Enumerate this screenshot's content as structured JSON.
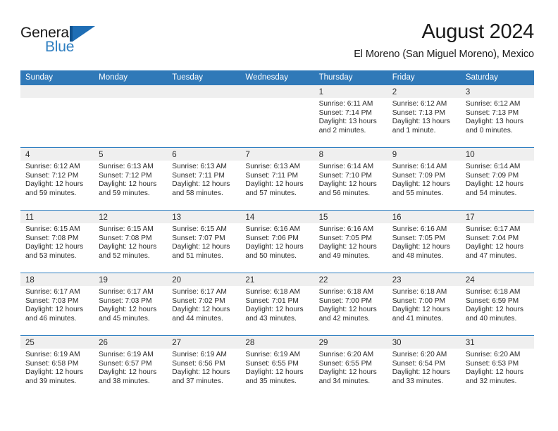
{
  "brand": {
    "name_top": "General",
    "name_bottom": "Blue",
    "mark": "triangle-logo",
    "accent": "#2f7fc1",
    "dark_accent": "#12538f"
  },
  "header": {
    "title": "August 2024",
    "subtitle": "El Moreno (San Miguel Moreno), Mexico"
  },
  "colors": {
    "header_bar": "#3079b8",
    "date_strip": "#efefef",
    "row_rule": "#2f7fc1",
    "text": "#2b2b2b"
  },
  "calendar": {
    "weekdays": [
      "Sunday",
      "Monday",
      "Tuesday",
      "Wednesday",
      "Thursday",
      "Friday",
      "Saturday"
    ],
    "weeks": [
      [
        {
          "day": "",
          "lines": []
        },
        {
          "day": "",
          "lines": []
        },
        {
          "day": "",
          "lines": []
        },
        {
          "day": "",
          "lines": []
        },
        {
          "day": "1",
          "lines": [
            "Sunrise: 6:11 AM",
            "Sunset: 7:14 PM",
            "Daylight: 13 hours",
            "and 2 minutes."
          ]
        },
        {
          "day": "2",
          "lines": [
            "Sunrise: 6:12 AM",
            "Sunset: 7:13 PM",
            "Daylight: 13 hours",
            "and 1 minute."
          ]
        },
        {
          "day": "3",
          "lines": [
            "Sunrise: 6:12 AM",
            "Sunset: 7:13 PM",
            "Daylight: 13 hours",
            "and 0 minutes."
          ]
        }
      ],
      [
        {
          "day": "4",
          "lines": [
            "Sunrise: 6:12 AM",
            "Sunset: 7:12 PM",
            "Daylight: 12 hours",
            "and 59 minutes."
          ]
        },
        {
          "day": "5",
          "lines": [
            "Sunrise: 6:13 AM",
            "Sunset: 7:12 PM",
            "Daylight: 12 hours",
            "and 59 minutes."
          ]
        },
        {
          "day": "6",
          "lines": [
            "Sunrise: 6:13 AM",
            "Sunset: 7:11 PM",
            "Daylight: 12 hours",
            "and 58 minutes."
          ]
        },
        {
          "day": "7",
          "lines": [
            "Sunrise: 6:13 AM",
            "Sunset: 7:11 PM",
            "Daylight: 12 hours",
            "and 57 minutes."
          ]
        },
        {
          "day": "8",
          "lines": [
            "Sunrise: 6:14 AM",
            "Sunset: 7:10 PM",
            "Daylight: 12 hours",
            "and 56 minutes."
          ]
        },
        {
          "day": "9",
          "lines": [
            "Sunrise: 6:14 AM",
            "Sunset: 7:09 PM",
            "Daylight: 12 hours",
            "and 55 minutes."
          ]
        },
        {
          "day": "10",
          "lines": [
            "Sunrise: 6:14 AM",
            "Sunset: 7:09 PM",
            "Daylight: 12 hours",
            "and 54 minutes."
          ]
        }
      ],
      [
        {
          "day": "11",
          "lines": [
            "Sunrise: 6:15 AM",
            "Sunset: 7:08 PM",
            "Daylight: 12 hours",
            "and 53 minutes."
          ]
        },
        {
          "day": "12",
          "lines": [
            "Sunrise: 6:15 AM",
            "Sunset: 7:08 PM",
            "Daylight: 12 hours",
            "and 52 minutes."
          ]
        },
        {
          "day": "13",
          "lines": [
            "Sunrise: 6:15 AM",
            "Sunset: 7:07 PM",
            "Daylight: 12 hours",
            "and 51 minutes."
          ]
        },
        {
          "day": "14",
          "lines": [
            "Sunrise: 6:16 AM",
            "Sunset: 7:06 PM",
            "Daylight: 12 hours",
            "and 50 minutes."
          ]
        },
        {
          "day": "15",
          "lines": [
            "Sunrise: 6:16 AM",
            "Sunset: 7:05 PM",
            "Daylight: 12 hours",
            "and 49 minutes."
          ]
        },
        {
          "day": "16",
          "lines": [
            "Sunrise: 6:16 AM",
            "Sunset: 7:05 PM",
            "Daylight: 12 hours",
            "and 48 minutes."
          ]
        },
        {
          "day": "17",
          "lines": [
            "Sunrise: 6:17 AM",
            "Sunset: 7:04 PM",
            "Daylight: 12 hours",
            "and 47 minutes."
          ]
        }
      ],
      [
        {
          "day": "18",
          "lines": [
            "Sunrise: 6:17 AM",
            "Sunset: 7:03 PM",
            "Daylight: 12 hours",
            "and 46 minutes."
          ]
        },
        {
          "day": "19",
          "lines": [
            "Sunrise: 6:17 AM",
            "Sunset: 7:03 PM",
            "Daylight: 12 hours",
            "and 45 minutes."
          ]
        },
        {
          "day": "20",
          "lines": [
            "Sunrise: 6:17 AM",
            "Sunset: 7:02 PM",
            "Daylight: 12 hours",
            "and 44 minutes."
          ]
        },
        {
          "day": "21",
          "lines": [
            "Sunrise: 6:18 AM",
            "Sunset: 7:01 PM",
            "Daylight: 12 hours",
            "and 43 minutes."
          ]
        },
        {
          "day": "22",
          "lines": [
            "Sunrise: 6:18 AM",
            "Sunset: 7:00 PM",
            "Daylight: 12 hours",
            "and 42 minutes."
          ]
        },
        {
          "day": "23",
          "lines": [
            "Sunrise: 6:18 AM",
            "Sunset: 7:00 PM",
            "Daylight: 12 hours",
            "and 41 minutes."
          ]
        },
        {
          "day": "24",
          "lines": [
            "Sunrise: 6:18 AM",
            "Sunset: 6:59 PM",
            "Daylight: 12 hours",
            "and 40 minutes."
          ]
        }
      ],
      [
        {
          "day": "25",
          "lines": [
            "Sunrise: 6:19 AM",
            "Sunset: 6:58 PM",
            "Daylight: 12 hours",
            "and 39 minutes."
          ]
        },
        {
          "day": "26",
          "lines": [
            "Sunrise: 6:19 AM",
            "Sunset: 6:57 PM",
            "Daylight: 12 hours",
            "and 38 minutes."
          ]
        },
        {
          "day": "27",
          "lines": [
            "Sunrise: 6:19 AM",
            "Sunset: 6:56 PM",
            "Daylight: 12 hours",
            "and 37 minutes."
          ]
        },
        {
          "day": "28",
          "lines": [
            "Sunrise: 6:19 AM",
            "Sunset: 6:55 PM",
            "Daylight: 12 hours",
            "and 35 minutes."
          ]
        },
        {
          "day": "29",
          "lines": [
            "Sunrise: 6:20 AM",
            "Sunset: 6:55 PM",
            "Daylight: 12 hours",
            "and 34 minutes."
          ]
        },
        {
          "day": "30",
          "lines": [
            "Sunrise: 6:20 AM",
            "Sunset: 6:54 PM",
            "Daylight: 12 hours",
            "and 33 minutes."
          ]
        },
        {
          "day": "31",
          "lines": [
            "Sunrise: 6:20 AM",
            "Sunset: 6:53 PM",
            "Daylight: 12 hours",
            "and 32 minutes."
          ]
        }
      ]
    ]
  }
}
